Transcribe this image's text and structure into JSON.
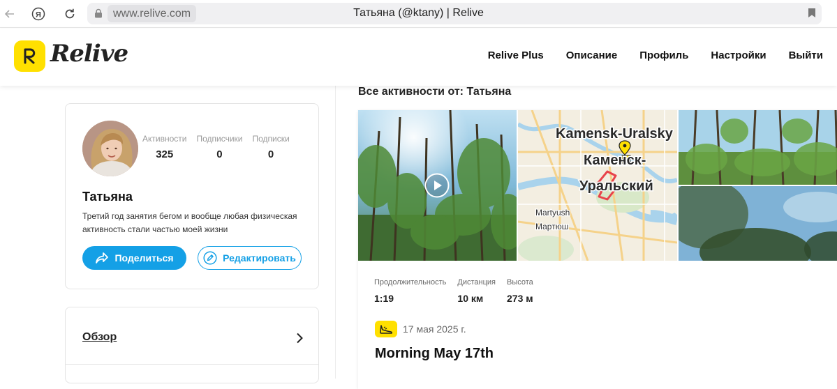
{
  "browser": {
    "url": "www.relive.com",
    "tab_title": "Татьяна (@ktany) | Relive"
  },
  "header": {
    "logo_text": "Relive",
    "nav": [
      "Relive Plus",
      "Описание",
      "Профиль",
      "Настройки",
      "Выйти"
    ]
  },
  "profile": {
    "stats": [
      {
        "label": "Активности",
        "value": "325"
      },
      {
        "label": "Подписчики",
        "value": "0"
      },
      {
        "label": "Подписки",
        "value": "0"
      }
    ],
    "name": "Татьяна",
    "bio": "Третий год занятия бегом и вообще любая физическая активность стали частью моей жизни",
    "share_label": "Поделиться",
    "edit_label": "Редактировать"
  },
  "menu": {
    "items": [
      {
        "label": "Обзор"
      }
    ]
  },
  "feed": {
    "heading": "Все активности от: Татьяна",
    "map_labels": {
      "city_en": "Kamensk-Uralsky",
      "city_ru_1": "Каменск-",
      "city_ru_2": "Уральский",
      "village_en": "Martyush",
      "village_ru": "Мартюш"
    },
    "metrics": [
      {
        "label": "Продолжительность",
        "value": "1:19"
      },
      {
        "label": "Дистанция",
        "value": "10 км"
      },
      {
        "label": "Высота",
        "value": "273 м"
      }
    ],
    "date": "17 мая 2025 г.",
    "title": "Morning May 17th"
  },
  "colors": {
    "brand_yellow": "#ffe000",
    "accent_blue": "#14a0e6"
  }
}
